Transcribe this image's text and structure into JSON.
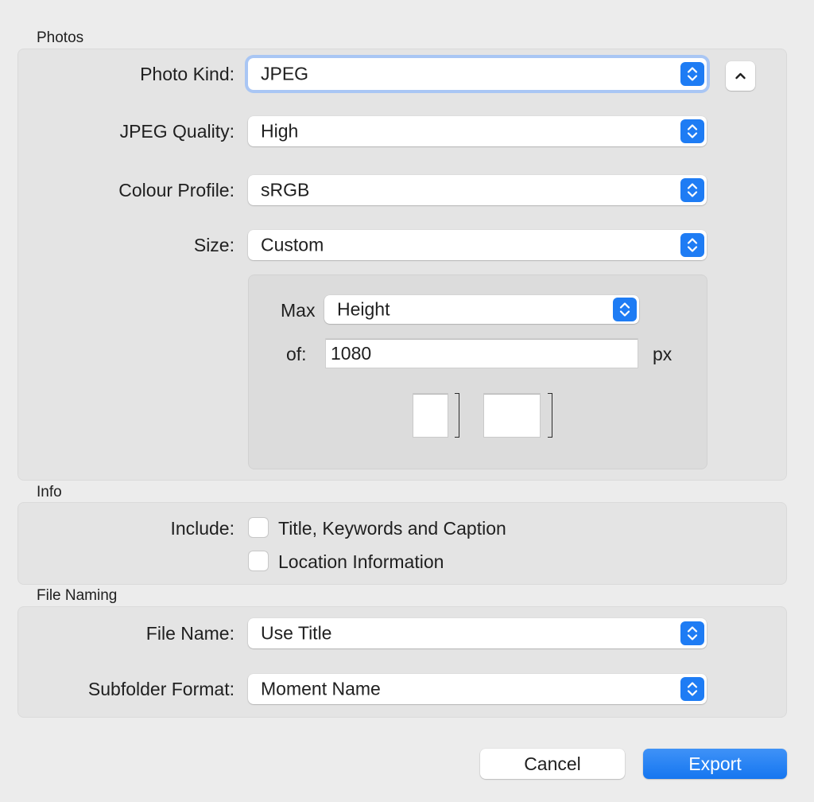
{
  "photos": {
    "section_title": "Photos",
    "photo_kind": {
      "label": "Photo Kind:",
      "value": "JPEG"
    },
    "jpeg_quality": {
      "label": "JPEG Quality:",
      "value": "High"
    },
    "colour_profile": {
      "label": "Colour Profile:",
      "value": "sRGB"
    },
    "size": {
      "label": "Size:",
      "value": "Custom",
      "max_label": "Max",
      "max_value": "Height",
      "of_label": "of:",
      "of_value": "1080",
      "unit": "px"
    },
    "disclosure_icon": "chevron-up-icon"
  },
  "info": {
    "section_title": "Info",
    "include_label": "Include:",
    "options": [
      {
        "label": "Title, Keywords and Caption",
        "checked": false
      },
      {
        "label": "Location Information",
        "checked": false
      }
    ]
  },
  "file_naming": {
    "section_title": "File Naming",
    "file_name": {
      "label": "File Name:",
      "value": "Use Title"
    },
    "subfolder_format": {
      "label": "Subfolder Format:",
      "value": "Moment Name"
    }
  },
  "buttons": {
    "cancel": "Cancel",
    "export": "Export"
  },
  "colors": {
    "accent": "#1e7cf4",
    "focus_ring": "#a9c6f4",
    "background": "#ececec"
  }
}
